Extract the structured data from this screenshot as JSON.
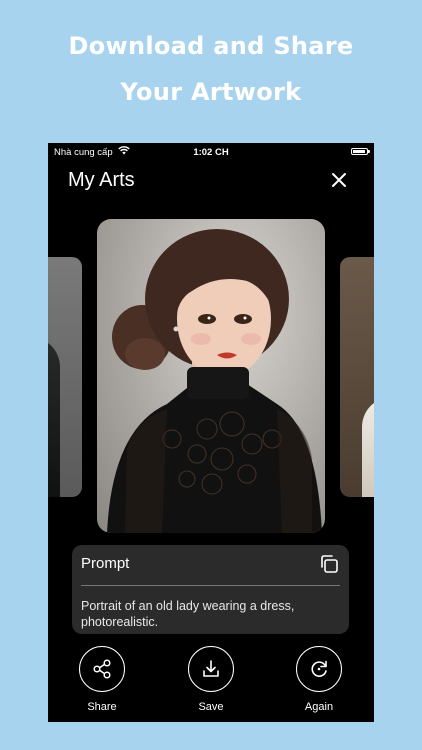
{
  "headline": {
    "line1": "Download and Share",
    "line2": "Your Artwork"
  },
  "status_bar": {
    "carrier": "Nhà cung cấp",
    "time": "1:02 CH"
  },
  "screen": {
    "title": "My Arts",
    "close_icon": "close-icon"
  },
  "prompt": {
    "label": "Prompt",
    "text": "Portrait of an old lady wearing a dress, photorealistic.",
    "copy_icon": "copy-icon"
  },
  "actions": [
    {
      "label": "Share",
      "icon": "share-icon"
    },
    {
      "label": "Save",
      "icon": "download-icon"
    },
    {
      "label": "Again",
      "icon": "refresh-icon"
    }
  ]
}
